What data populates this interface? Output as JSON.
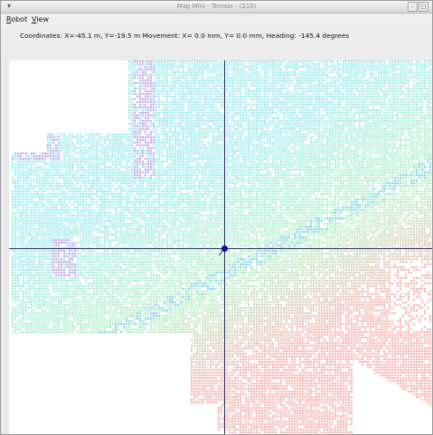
{
  "window": {
    "title": "Map Mini - Terrain - (210)",
    "menu_icon": "window-menu-icon",
    "controls": [
      "–",
      "□"
    ]
  },
  "menu": {
    "robot": "Robot",
    "robot_mnemonic": "R",
    "robot_rest": "obot",
    "view": "View",
    "view_mnemonic": "V",
    "view_rest": "iew"
  },
  "status": {
    "text": "Coordinates: X=-45.1 m, Y=-19.5 m  Movement: X= 0.0 mm, Y= 0.0 mm, Heading: -145.4 degrees"
  },
  "robot": {
    "heading_deg": -145.4
  },
  "colors": {
    "crosshair": "#2f3060",
    "robot": "#0a0aa8",
    "low": "#8fe8ea",
    "mid": "#a8efb8",
    "high": "#f2aaa6",
    "wall": "#b59be6"
  }
}
